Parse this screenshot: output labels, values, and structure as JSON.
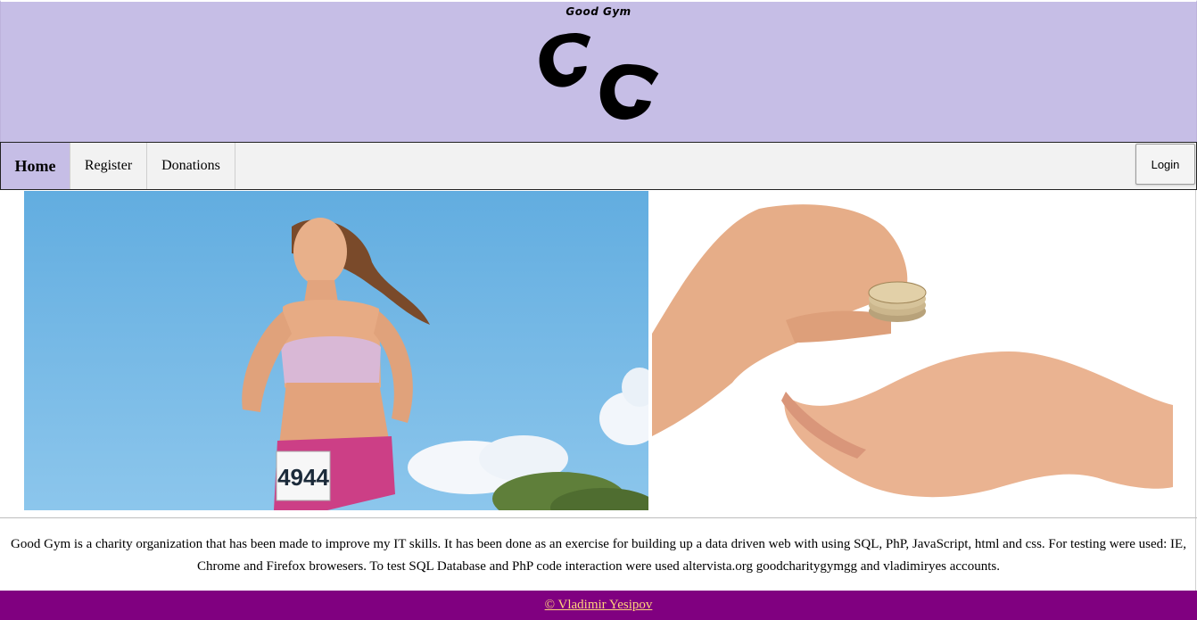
{
  "header": {
    "brand_title": "Good Gym",
    "logo_text": "GG",
    "background_color": "#c6bee6"
  },
  "nav": {
    "items": [
      {
        "label": "Home",
        "active": true
      },
      {
        "label": "Register",
        "active": false
      },
      {
        "label": "Donations",
        "active": false
      }
    ],
    "login_label": "Login"
  },
  "images": {
    "runner_bib_number": "4944",
    "runner_icon": "runner-photo",
    "donation_icon": "coin-hands-photo"
  },
  "description": "Good Gym is a charity organization that has been made to improve my IT skills. It has been done as an exercise for building up a data driven web with using SQL, PhP, JavaScript, html and css. For testing were used: IE, Chrome and Firefox browesers. To test SQL Database and PhP code interaction were used altervista.org goodcharitygymgg and vladimiryes accounts.",
  "footer": {
    "copyright": "© Vladimir Yesipov",
    "background_color": "#800080",
    "link_color": "#ffd37a"
  }
}
